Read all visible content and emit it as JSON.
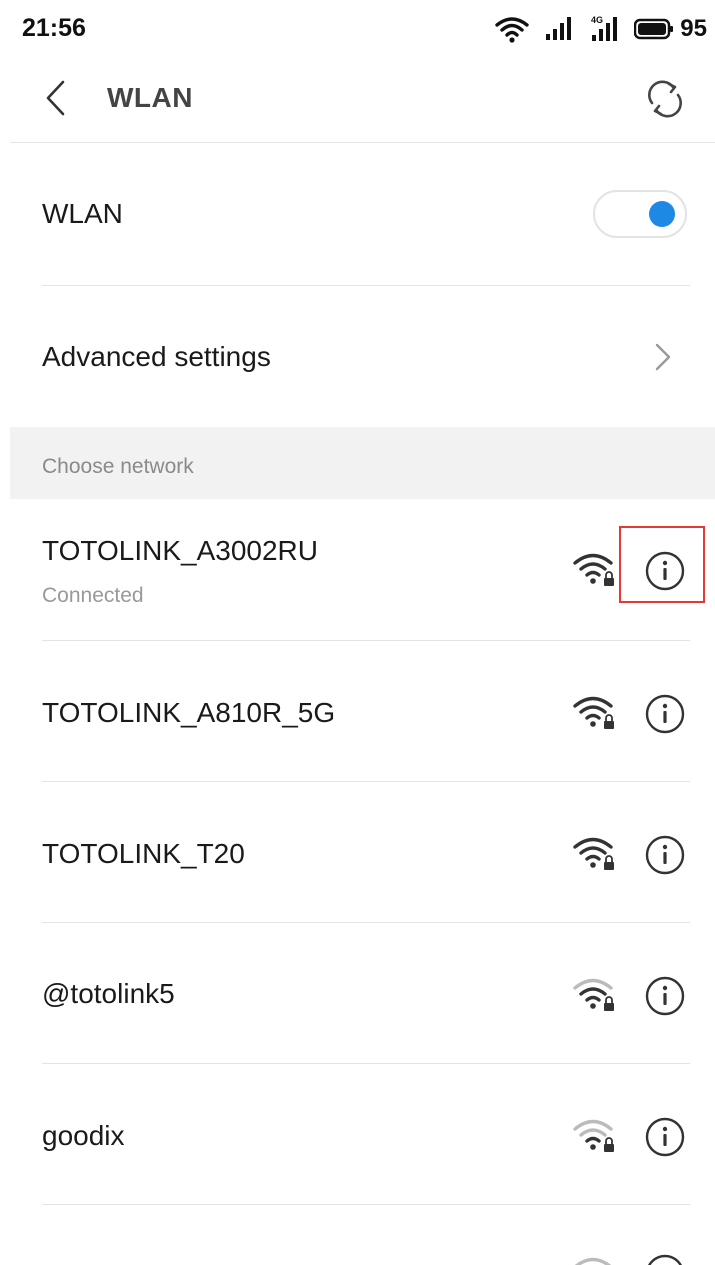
{
  "status_bar": {
    "time": "21:56",
    "battery_percent": "95",
    "icons": [
      "wifi-signal-icon",
      "cell-signal-icon",
      "cell-signal-4g-icon",
      "battery-icon"
    ]
  },
  "header": {
    "title": "WLAN",
    "back_icon": "chevron-left-icon",
    "refresh_icon": "refresh-icon"
  },
  "wlan_toggle": {
    "label": "WLAN",
    "enabled": true,
    "accent_color": "#1e88e5"
  },
  "advanced_settings": {
    "label": "Advanced settings",
    "icon": "chevron-right-icon"
  },
  "networks_section": {
    "header": "Choose network",
    "networks": [
      {
        "ssid": "TOTOLINK_A3002RU",
        "status": "Connected",
        "signal": "strong",
        "secured": true,
        "highlighted": true
      },
      {
        "ssid": "TOTOLINK_A810R_5G",
        "status": "",
        "signal": "strong",
        "secured": true
      },
      {
        "ssid": "TOTOLINK_T20",
        "status": "",
        "signal": "strong",
        "secured": true
      },
      {
        "ssid": "@totolink5",
        "status": "",
        "signal": "medium",
        "secured": true
      },
      {
        "ssid": "goodix",
        "status": "",
        "signal": "weak",
        "secured": true
      }
    ]
  },
  "colors": {
    "highlight_border": "#e53935",
    "section_bg": "#f2f2f2"
  }
}
